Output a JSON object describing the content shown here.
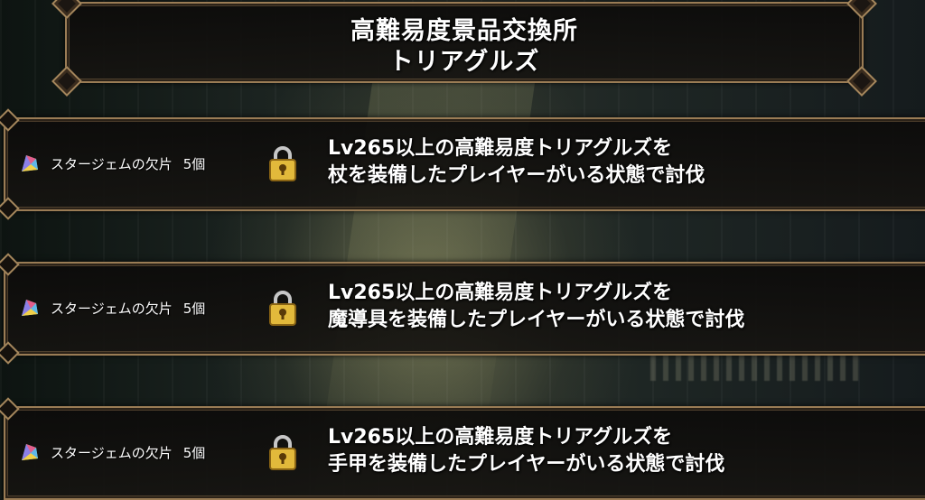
{
  "header": {
    "title_line1": "高難易度景品交換所",
    "title_line2": "トリアグルズ"
  },
  "rewards": [
    {
      "item": "スタージェムの欠片",
      "quantity": "5個",
      "locked": true,
      "condition_line1": "Lv265以上の高難易度トリアグルズを",
      "condition_line2": "杖を装備したプレイヤーがいる状態で討伐"
    },
    {
      "item": "スタージェムの欠片",
      "quantity": "5個",
      "locked": true,
      "condition_line1": "Lv265以上の高難易度トリアグルズを",
      "condition_line2": "魔導具を装備したプレイヤーがいる状態で討伐"
    },
    {
      "item": "スタージェムの欠片",
      "quantity": "5個",
      "locked": true,
      "condition_line1": "Lv265以上の高難易度トリアグルズを",
      "condition_line2": "手甲を装備したプレイヤーがいる状態で討伐"
    }
  ],
  "icons": {
    "reward": "star-gem-fragment-icon",
    "status": "padlock-icon"
  },
  "colors": {
    "panel_border": "#9a7c55",
    "text": "#ffffff",
    "lock_gold": "#e2b93b"
  }
}
